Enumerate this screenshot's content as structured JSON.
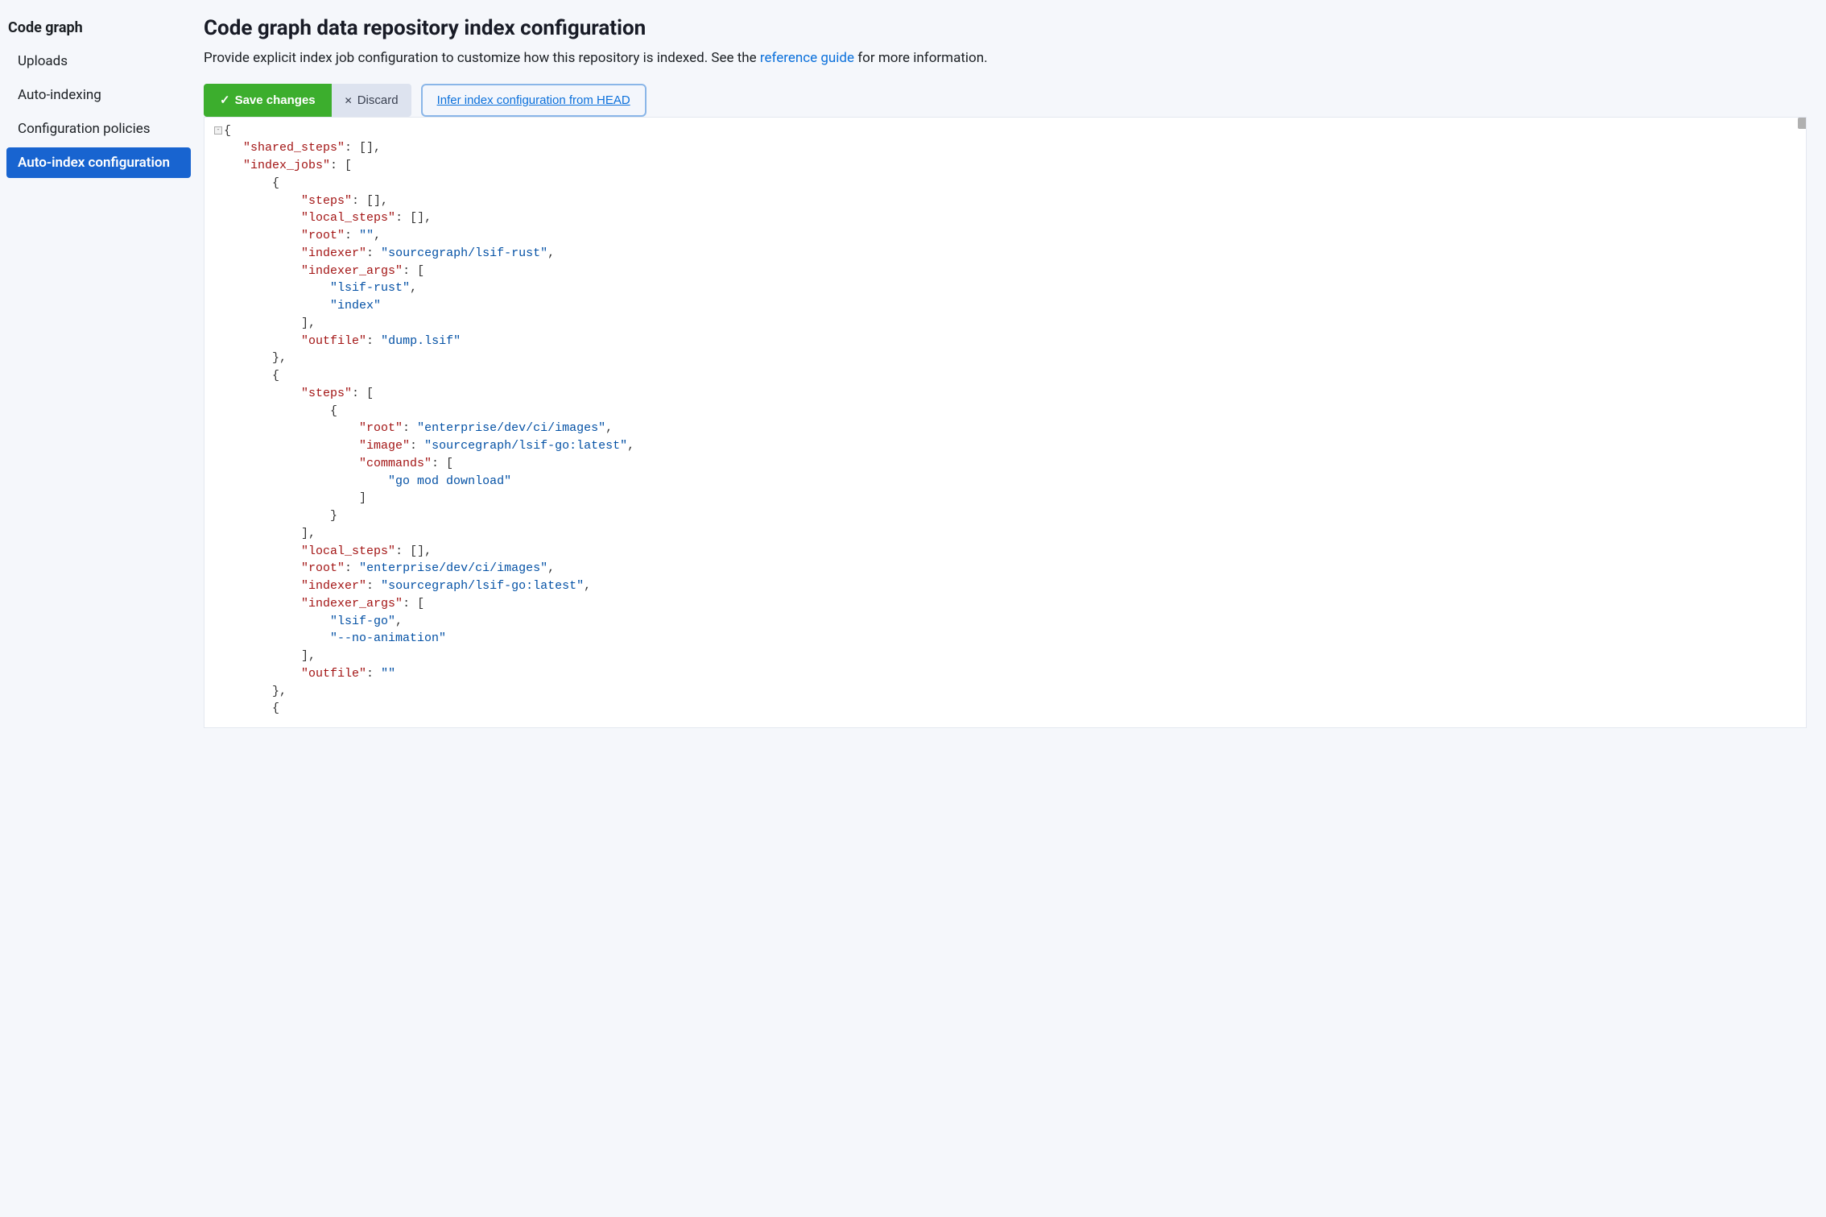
{
  "sidebar": {
    "title": "Code graph",
    "items": [
      {
        "label": "Uploads",
        "active": false
      },
      {
        "label": "Auto-indexing",
        "active": false
      },
      {
        "label": "Configuration policies",
        "active": false
      },
      {
        "label": "Auto-index configuration",
        "active": true
      }
    ]
  },
  "page": {
    "title": "Code graph data repository index configuration",
    "description_pre": "Provide explicit index job configuration to customize how this repository is indexed. See the ",
    "description_link": "reference guide",
    "description_post": " for more information."
  },
  "toolbar": {
    "save_label": "Save changes",
    "discard_label": "Discard",
    "infer_label": "Infer index configuration from HEAD"
  },
  "editor": {
    "config": {
      "shared_steps": [],
      "index_jobs": [
        {
          "steps": [],
          "local_steps": [],
          "root": "",
          "indexer": "sourcegraph/lsif-rust",
          "indexer_args": [
            "lsif-rust",
            "index"
          ],
          "outfile": "dump.lsif"
        },
        {
          "steps": [
            {
              "root": "enterprise/dev/ci/images",
              "image": "sourcegraph/lsif-go:latest",
              "commands": [
                "go mod download"
              ]
            }
          ],
          "local_steps": [],
          "root": "enterprise/dev/ci/images",
          "indexer": "sourcegraph/lsif-go:latest",
          "indexer_args": [
            "lsif-go",
            "--no-animation"
          ],
          "outfile": ""
        }
      ]
    }
  }
}
